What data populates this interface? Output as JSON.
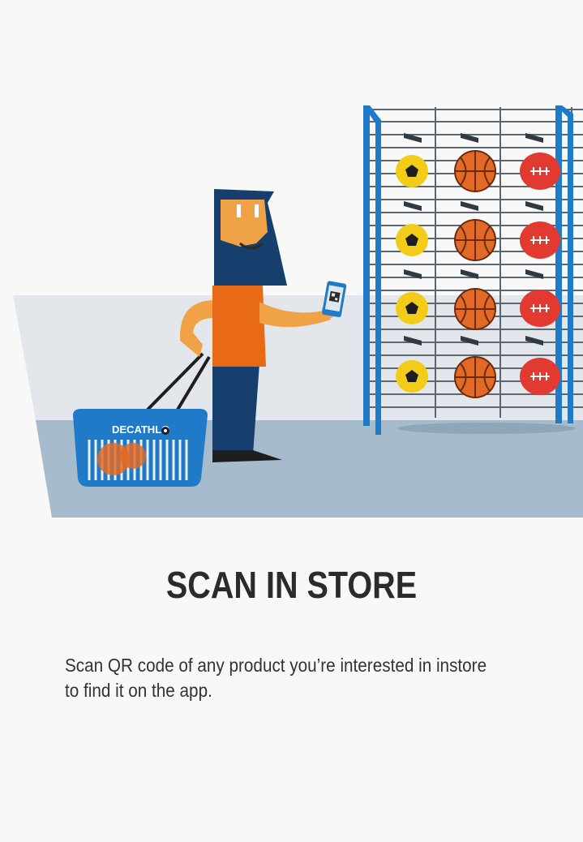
{
  "illustration": {
    "basket_brand": "DECATHLO"
  },
  "colors": {
    "background": "#f8f8f8",
    "floor": "#a6bccd",
    "wall": "#e3e7ec",
    "rack_blue": "#1f7ac8",
    "shirt_orange": "#e86a17",
    "pants_navy": "#173f6e",
    "basketball": "#e26a26",
    "football_red": "#e23a31",
    "soccer_yellow": "#f2cc18"
  },
  "onboarding": {
    "title": "SCAN IN STORE",
    "description_line1": "Scan QR code of any product you’re interested in instore",
    "description_line2": "to find it on the app."
  }
}
